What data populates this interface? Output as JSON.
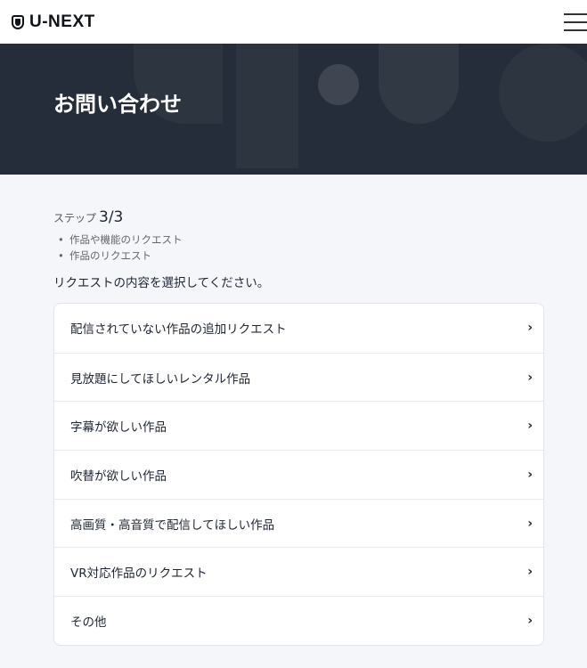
{
  "header": {
    "logo": "U-NEXT"
  },
  "hero": {
    "title": "お問い合わせ"
  },
  "step": {
    "label": "ステップ",
    "value": "3/3"
  },
  "breadcrumb": [
    "作品や機能のリクエスト",
    "作品のリクエスト"
  ],
  "prompt": "リクエストの内容を選択してください。",
  "options": [
    "配信されていない作品の追加リクエスト",
    "見放題にしてほしいレンタル作品",
    "字幕が欲しい作品",
    "吹替が欲しい作品",
    "高画質・高音質で配信してほしい作品",
    "VR対応作品のリクエスト",
    "その他"
  ]
}
